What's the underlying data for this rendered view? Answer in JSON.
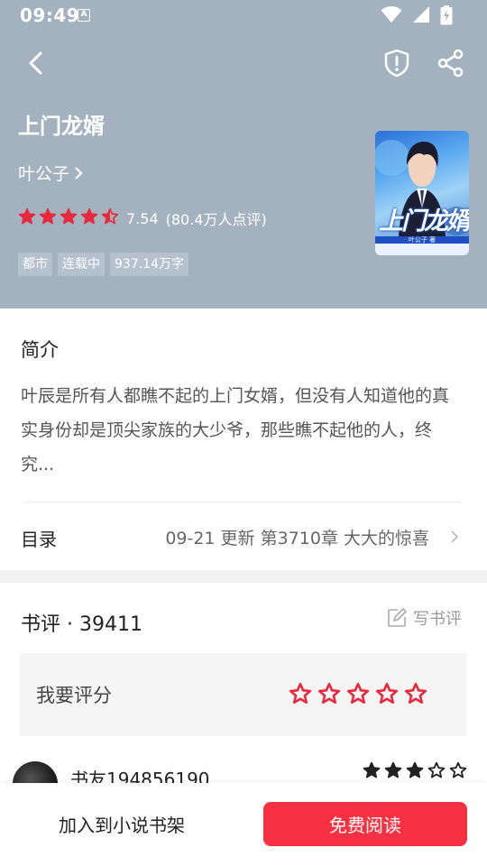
{
  "status_bar": {
    "time": "09:49",
    "notification_badge": "A",
    "icons": [
      "wifi-icon",
      "signal-icon",
      "battery-charging-icon"
    ]
  },
  "nav": {
    "back_icon": "back-arrow-icon",
    "report_icon": "shield-alert-icon",
    "share_icon": "share-icon"
  },
  "book": {
    "title": "上门龙婿",
    "author": "叶公子",
    "rating_score": "7.54",
    "rating_count": "(80.4万人点评)",
    "rating_stars": 4.5,
    "tags": [
      "都市",
      "连载中",
      "937.14万字"
    ],
    "cover_title": "上门龙婿",
    "cover_author": "叶公子  著"
  },
  "intro": {
    "heading": "简介",
    "text": "叶辰是所有人都瞧不起的上门女婿，但没有人知道他的真实身份却是顶尖家族的大少爷，那些瞧不起他的人，终究..."
  },
  "toc": {
    "label": "目录",
    "update_info": "09-21  更新  第3710章 大大的惊喜"
  },
  "reviews": {
    "heading": "书评 · 39411",
    "write_label": "写书评",
    "rate_prompt": "我要评分",
    "rate_star_count": 5,
    "items": [
      {
        "user": "书友194856190",
        "stars_filled": 3,
        "stars_total": 5
      }
    ]
  },
  "bottom": {
    "add_to_shelf": "加入到小说书架",
    "read_free": "免费阅读"
  },
  "colors": {
    "header_bg": "#a4b2bf",
    "accent_red": "#f83142",
    "star_red": "#e8283c"
  }
}
